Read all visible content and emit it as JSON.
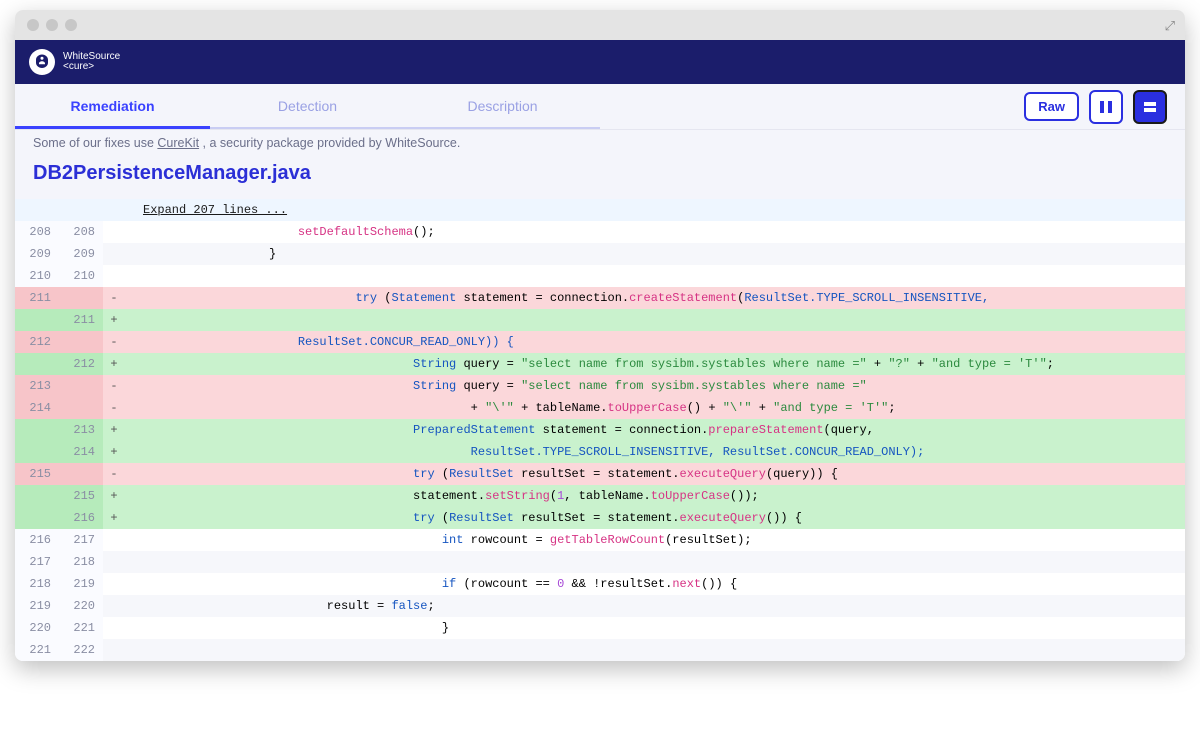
{
  "brand": {
    "name": "WhiteSource",
    "sub": "<cure>"
  },
  "tabs": [
    {
      "label": "Remediation",
      "active": true
    },
    {
      "label": "Detection",
      "active": false
    },
    {
      "label": "Description",
      "active": false
    }
  ],
  "actions": {
    "raw": "Raw"
  },
  "context": {
    "prefix": "Some of our fixes use ",
    "link": "CureKit",
    "suffix": " , a security package provided by WhiteSource."
  },
  "file": {
    "name": "DB2PersistenceManager.java"
  },
  "expand": {
    "label": "Expand 207 lines ..."
  },
  "diff": [
    {
      "old": "208",
      "new": "208",
      "m": " ",
      "type": "ctx",
      "tokens": [
        {
          "t": "                        ",
          "c": ""
        },
        {
          "t": "setDefaultSchema",
          "c": "tk-fn"
        },
        {
          "t": "();",
          "c": ""
        }
      ]
    },
    {
      "old": "209",
      "new": "209",
      "m": " ",
      "type": "alt",
      "tokens": [
        {
          "t": "                    }",
          "c": ""
        }
      ]
    },
    {
      "old": "210",
      "new": "210",
      "m": " ",
      "type": "ctx",
      "tokens": [
        {
          "t": "",
          "c": ""
        }
      ]
    },
    {
      "old": "211",
      "new": "",
      "m": "-",
      "type": "del",
      "tokens": [
        {
          "t": "                                ",
          "c": ""
        },
        {
          "t": "try",
          "c": "tk-kw"
        },
        {
          "t": " (",
          "c": ""
        },
        {
          "t": "Statement",
          "c": "tk-type"
        },
        {
          "t": " statement = connection.",
          "c": ""
        },
        {
          "t": "createStatement",
          "c": "tk-fn"
        },
        {
          "t": "(",
          "c": ""
        },
        {
          "t": "ResultSet",
          "c": "tk-type"
        },
        {
          "t": ".TYPE_SCROLL_INSENSITIVE,",
          "c": "tk-const"
        }
      ]
    },
    {
      "old": "",
      "new": "211",
      "m": "+",
      "type": "add",
      "tokens": [
        {
          "t": "",
          "c": ""
        }
      ]
    },
    {
      "old": "212",
      "new": "",
      "m": "-",
      "type": "del",
      "tokens": [
        {
          "t": "                        ",
          "c": ""
        },
        {
          "t": "ResultSet",
          "c": "tk-type"
        },
        {
          "t": ".CONCUR_READ_ONLY)) {",
          "c": "tk-const"
        }
      ]
    },
    {
      "old": "",
      "new": "212",
      "m": "+",
      "type": "add",
      "tokens": [
        {
          "t": "                                        ",
          "c": ""
        },
        {
          "t": "String",
          "c": "tk-type"
        },
        {
          "t": " query = ",
          "c": ""
        },
        {
          "t": "\"select name from sysibm.systables where name =\"",
          "c": "tk-str"
        },
        {
          "t": " + ",
          "c": ""
        },
        {
          "t": "\"?\"",
          "c": "tk-str"
        },
        {
          "t": " + ",
          "c": ""
        },
        {
          "t": "\"and type = 'T'\"",
          "c": "tk-str"
        },
        {
          "t": ";",
          "c": ""
        }
      ]
    },
    {
      "old": "213",
      "new": "",
      "m": "-",
      "type": "del",
      "tokens": [
        {
          "t": "                                        ",
          "c": ""
        },
        {
          "t": "String",
          "c": "tk-type"
        },
        {
          "t": " query = ",
          "c": ""
        },
        {
          "t": "\"select name from sysibm.systables where name =\"",
          "c": "tk-str"
        }
      ]
    },
    {
      "old": "214",
      "new": "",
      "m": "-",
      "type": "del",
      "tokens": [
        {
          "t": "                                                + ",
          "c": ""
        },
        {
          "t": "\"\\'\"",
          "c": "tk-str"
        },
        {
          "t": " + tableName.",
          "c": ""
        },
        {
          "t": "toUpperCase",
          "c": "tk-fn"
        },
        {
          "t": "() + ",
          "c": ""
        },
        {
          "t": "\"\\'\"",
          "c": "tk-str"
        },
        {
          "t": " + ",
          "c": ""
        },
        {
          "t": "\"and type = 'T'\"",
          "c": "tk-str"
        },
        {
          "t": ";",
          "c": ""
        }
      ]
    },
    {
      "old": "",
      "new": "213",
      "m": "+",
      "type": "add",
      "tokens": [
        {
          "t": "                                        ",
          "c": ""
        },
        {
          "t": "PreparedStatement",
          "c": "tk-type"
        },
        {
          "t": " statement = connection.",
          "c": ""
        },
        {
          "t": "prepareStatement",
          "c": "tk-fn"
        },
        {
          "t": "(query,",
          "c": ""
        }
      ]
    },
    {
      "old": "",
      "new": "214",
      "m": "+",
      "type": "add",
      "tokens": [
        {
          "t": "                                                ",
          "c": ""
        },
        {
          "t": "ResultSet",
          "c": "tk-type"
        },
        {
          "t": ".TYPE_SCROLL_INSENSITIVE, ",
          "c": "tk-const"
        },
        {
          "t": "ResultSet",
          "c": "tk-type"
        },
        {
          "t": ".CONCUR_READ_ONLY);",
          "c": "tk-const"
        }
      ]
    },
    {
      "old": "215",
      "new": "",
      "m": "-",
      "type": "del",
      "tokens": [
        {
          "t": "                                        ",
          "c": ""
        },
        {
          "t": "try",
          "c": "tk-kw"
        },
        {
          "t": " (",
          "c": ""
        },
        {
          "t": "ResultSet",
          "c": "tk-type"
        },
        {
          "t": " resultSet = statement.",
          "c": ""
        },
        {
          "t": "executeQuery",
          "c": "tk-fn"
        },
        {
          "t": "(query)) {",
          "c": ""
        }
      ]
    },
    {
      "old": "",
      "new": "215",
      "m": "+",
      "type": "add",
      "tokens": [
        {
          "t": "                                        statement.",
          "c": ""
        },
        {
          "t": "setString",
          "c": "tk-fn"
        },
        {
          "t": "(",
          "c": ""
        },
        {
          "t": "1",
          "c": "tk-num"
        },
        {
          "t": ", tableName.",
          "c": ""
        },
        {
          "t": "toUpperCase",
          "c": "tk-fn"
        },
        {
          "t": "());",
          "c": ""
        }
      ]
    },
    {
      "old": "",
      "new": "216",
      "m": "+",
      "type": "add",
      "tokens": [
        {
          "t": "                                        ",
          "c": ""
        },
        {
          "t": "try",
          "c": "tk-kw"
        },
        {
          "t": " (",
          "c": ""
        },
        {
          "t": "ResultSet",
          "c": "tk-type"
        },
        {
          "t": " resultSet = statement.",
          "c": ""
        },
        {
          "t": "executeQuery",
          "c": "tk-fn"
        },
        {
          "t": "()) {",
          "c": ""
        }
      ]
    },
    {
      "old": "216",
      "new": "217",
      "m": " ",
      "type": "ctx",
      "tokens": [
        {
          "t": "                                            ",
          "c": ""
        },
        {
          "t": "int",
          "c": "tk-kw"
        },
        {
          "t": " rowcount = ",
          "c": ""
        },
        {
          "t": "getTableRowCount",
          "c": "tk-fn"
        },
        {
          "t": "(resultSet);",
          "c": ""
        }
      ]
    },
    {
      "old": "217",
      "new": "218",
      "m": " ",
      "type": "alt",
      "tokens": [
        {
          "t": "",
          "c": ""
        }
      ]
    },
    {
      "old": "218",
      "new": "219",
      "m": " ",
      "type": "ctx",
      "tokens": [
        {
          "t": "                                            ",
          "c": ""
        },
        {
          "t": "if",
          "c": "tk-kw"
        },
        {
          "t": " (rowcount == ",
          "c": ""
        },
        {
          "t": "0",
          "c": "tk-num"
        },
        {
          "t": " && !resultSet.",
          "c": ""
        },
        {
          "t": "next",
          "c": "tk-fn"
        },
        {
          "t": "()) {",
          "c": ""
        }
      ]
    },
    {
      "old": "219",
      "new": "220",
      "m": " ",
      "type": "alt",
      "tokens": [
        {
          "t": "                            result = ",
          "c": ""
        },
        {
          "t": "false",
          "c": "tk-kw"
        },
        {
          "t": ";",
          "c": ""
        }
      ]
    },
    {
      "old": "220",
      "new": "221",
      "m": " ",
      "type": "ctx",
      "tokens": [
        {
          "t": "                                            }",
          "c": ""
        }
      ]
    },
    {
      "old": "221",
      "new": "222",
      "m": " ",
      "type": "alt",
      "tokens": [
        {
          "t": "",
          "c": ""
        }
      ]
    }
  ]
}
